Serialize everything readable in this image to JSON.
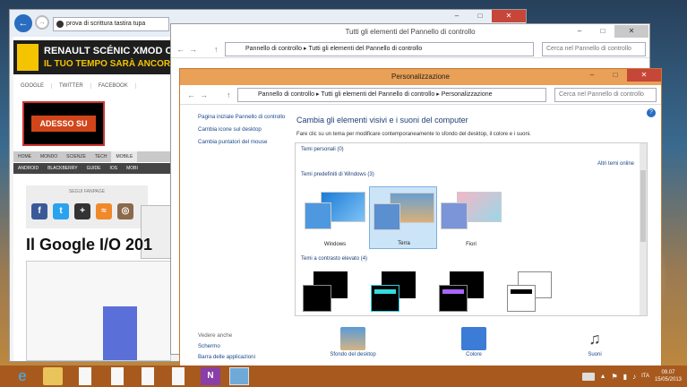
{
  "browser": {
    "address": "prova di scrittura tastira tupa",
    "site": {
      "banner_line1": "RENAULT SCÉNIC XMOD C",
      "banner_line2": "IL TUO TEMPO SARÀ ANCORA PIÙ",
      "social_links": [
        "GOOGLE",
        "TWITTER",
        "FACEBOOK"
      ],
      "ad_text": "ADESSO SU",
      "nav": [
        "HOME",
        "MONDO",
        "SCIENZE",
        "TECH",
        "MOBILE"
      ],
      "subnav": [
        "ANDROID",
        "BLACKBERRY",
        "GUIDE",
        "IOS",
        "MOBI"
      ],
      "follow_label": "SEGUI FANPAGE",
      "headline": "Il Google I/O 201"
    }
  },
  "control_panel": {
    "title": "Tutti gli elementi del Pannello di controllo",
    "breadcrumb": [
      "Pannello di controllo",
      "Tutti gli elementi del Pannello di controllo"
    ],
    "search_placeholder": "Cerca nel Pannello di controllo"
  },
  "personalization": {
    "title": "Personalizzazione",
    "breadcrumb": [
      "Pannello di controllo",
      "Tutti gli elementi del Pannello di controllo",
      "Personalizzazione"
    ],
    "search_placeholder": "Cerca nel Pannello di controllo",
    "left_links": [
      "Pagina iniziale Pannello di controllo",
      "Cambia icone sul desktop",
      "Cambia puntatori del mouse"
    ],
    "see_also_heading": "Vedere anche",
    "see_also_links": [
      "Schermo",
      "Barra delle applicazioni"
    ],
    "heading": "Cambia gli elementi visivi e i suoni del computer",
    "description": "Fare clic su un tema per modificare contemporaneamente lo sfondo del desktop, il colore e i suoni.",
    "group_personal": "Temi personali (0)",
    "more_themes_link": "Altri temi online",
    "group_windows": "Temi predefiniti di Windows (3)",
    "themes": [
      {
        "name": "Windows"
      },
      {
        "name": "Terra"
      },
      {
        "name": "Fiori"
      }
    ],
    "group_contrast": "Temi a contrasto elevato (4)",
    "bottom": [
      {
        "label": "Sfondo del desktop"
      },
      {
        "label": "Colore"
      },
      {
        "label": "Suoni"
      }
    ]
  },
  "taskbar": {
    "language": "ITA",
    "time": "09.07",
    "date": "15/05/2013"
  },
  "colors": {
    "accent": "#c47a35",
    "link": "#1a4a8a",
    "selection": "#cce4f7"
  }
}
